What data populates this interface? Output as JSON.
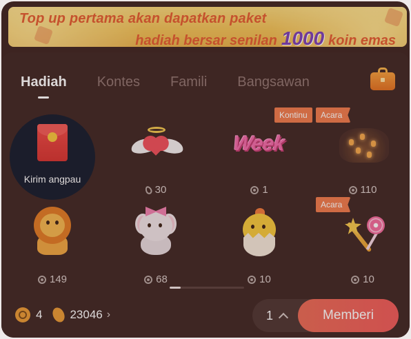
{
  "banner": {
    "line1": "Top up pertama akan dapatkan paket",
    "line2_prefix": "hadiah bersar senilan",
    "line2_highlight": "1000",
    "line2_suffix": "koin emas"
  },
  "tabs": [
    {
      "label": "Hadiah",
      "active": true
    },
    {
      "label": "Kontes",
      "active": false
    },
    {
      "label": "Famili",
      "active": false
    },
    {
      "label": "Bangsawan",
      "active": false
    }
  ],
  "gifts": [
    {
      "name": "Kirim angpau",
      "price": "",
      "icon": "red-envelope-icon",
      "tag": "",
      "selected": true
    },
    {
      "name": "",
      "price": "30",
      "currency": "bean",
      "icon": "winged-heart-icon",
      "tag": ""
    },
    {
      "name": "",
      "price": "1",
      "currency": "coin",
      "icon": "week-text-icon",
      "tag": "Kontinu"
    },
    {
      "name": "",
      "price": "110",
      "currency": "coin",
      "icon": "sky-lanterns-icon",
      "tag": "Acara"
    },
    {
      "name": "",
      "price": "149",
      "currency": "coin",
      "icon": "lion-icon",
      "tag": ""
    },
    {
      "name": "",
      "price": "68",
      "currency": "coin",
      "icon": "elephant-icon",
      "tag": ""
    },
    {
      "name": "",
      "price": "10",
      "currency": "coin",
      "icon": "chick-in-egg-icon",
      "tag": ""
    },
    {
      "name": "",
      "price": "10",
      "currency": "coin",
      "icon": "magic-wand-lollipop-icon",
      "tag": "Acara"
    }
  ],
  "gift_art_text": {
    "week": "Week"
  },
  "balance": {
    "coins": "4",
    "beans": "23046",
    "chevron": "›"
  },
  "send": {
    "quantity": "1",
    "button_label": "Memberi"
  },
  "colors": {
    "accent": "#ef5a58",
    "tag": "#ef7b4b",
    "panel": "#3f2623",
    "banner": "#f1c256"
  }
}
